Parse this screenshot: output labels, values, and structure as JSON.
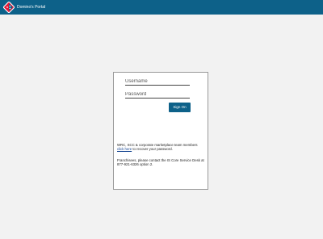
{
  "header": {
    "title": "Domino's Portal",
    "logo_icon": "dominos-logo-icon",
    "bar_color": "#0d6189"
  },
  "login": {
    "username_placeholder": "Username",
    "password_placeholder": "Password",
    "signon_label": "Sign On",
    "recover_pre": "WRC, SCC & corporate marketplace team members",
    "recover_link": "click here",
    "recover_post": " to recover your password.",
    "franchise_text": "Franchisees, please contact the IS Core Service Desk at 877-921-6326 option 2."
  }
}
